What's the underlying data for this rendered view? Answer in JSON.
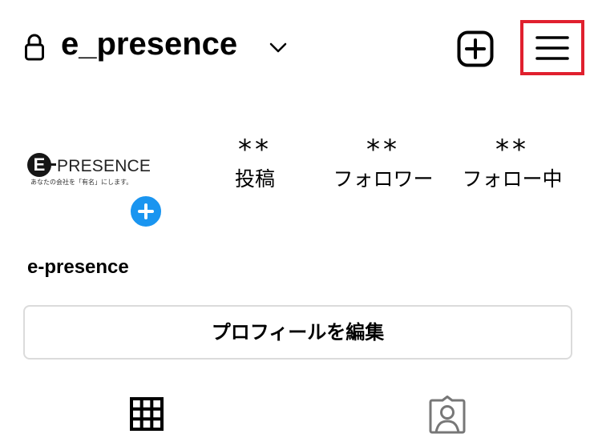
{
  "header": {
    "username": "e_presence",
    "lock_icon": "lock-icon",
    "dropdown_icon": "chevron-down-icon",
    "new_post_icon": "plus-square-icon",
    "menu_icon": "hamburger-menu-icon",
    "highlight_color": "#e0202e"
  },
  "profile": {
    "avatar_logo": {
      "letter": "E",
      "wordmark": "PRESENCE",
      "tagline": "あなたの会社を「有名」にします。"
    },
    "add_story_icon": "plus-circle-icon",
    "add_story_color": "#1a95f0",
    "stats": [
      {
        "value": "**",
        "label": "投稿"
      },
      {
        "value": "**",
        "label": "フォロワー"
      },
      {
        "value": "**",
        "label": "フォロー中"
      }
    ],
    "display_name": "e-presence",
    "edit_button_label": "プロフィールを編集"
  },
  "tabs": [
    {
      "icon": "grid-icon",
      "selected": true
    },
    {
      "icon": "tagged-person-icon",
      "selected": false
    }
  ]
}
